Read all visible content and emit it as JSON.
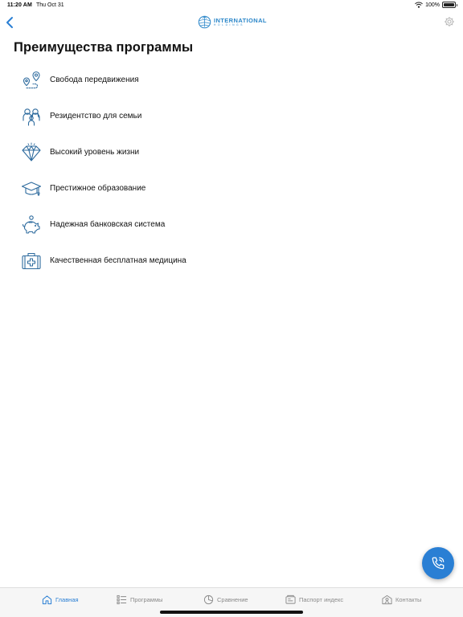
{
  "status_bar": {
    "time": "11:20 AM",
    "date": "Thu Oct 31",
    "battery": "100%"
  },
  "header": {
    "logo_main": "INTERNATIONAL",
    "logo_sub": "HOLDINGS",
    "back_icon": "chevron-left-icon",
    "settings_icon": "gear-icon"
  },
  "page": {
    "title": "Преимущества программы"
  },
  "benefits": [
    {
      "label": "Свобода передвижения",
      "icon": "route-pin-icon"
    },
    {
      "label": "Резидентство для семьи",
      "icon": "family-icon"
    },
    {
      "label": "Высокий уровень жизни",
      "icon": "diamond-icon"
    },
    {
      "label": "Престижное образование",
      "icon": "graduation-cap-icon"
    },
    {
      "label": "Надежная банковская система",
      "icon": "piggy-bank-icon"
    },
    {
      "label": "Качественная бесплатная медицина",
      "icon": "medical-kit-icon"
    }
  ],
  "fab": {
    "icon": "phone-call-icon"
  },
  "tabs": [
    {
      "label": "Главная",
      "icon": "home-icon",
      "active": true
    },
    {
      "label": "Программы",
      "icon": "list-icon",
      "active": false
    },
    {
      "label": "Сравнение",
      "icon": "pie-chart-icon",
      "active": false
    },
    {
      "label": "Паспорт индекс",
      "icon": "passport-icon",
      "active": false
    },
    {
      "label": "Контакты",
      "icon": "contacts-icon",
      "active": false
    }
  ],
  "colors": {
    "accent": "#2a7fd4",
    "icon_stroke": "#2e6b9e",
    "tab_inactive": "#8a8a8a"
  }
}
